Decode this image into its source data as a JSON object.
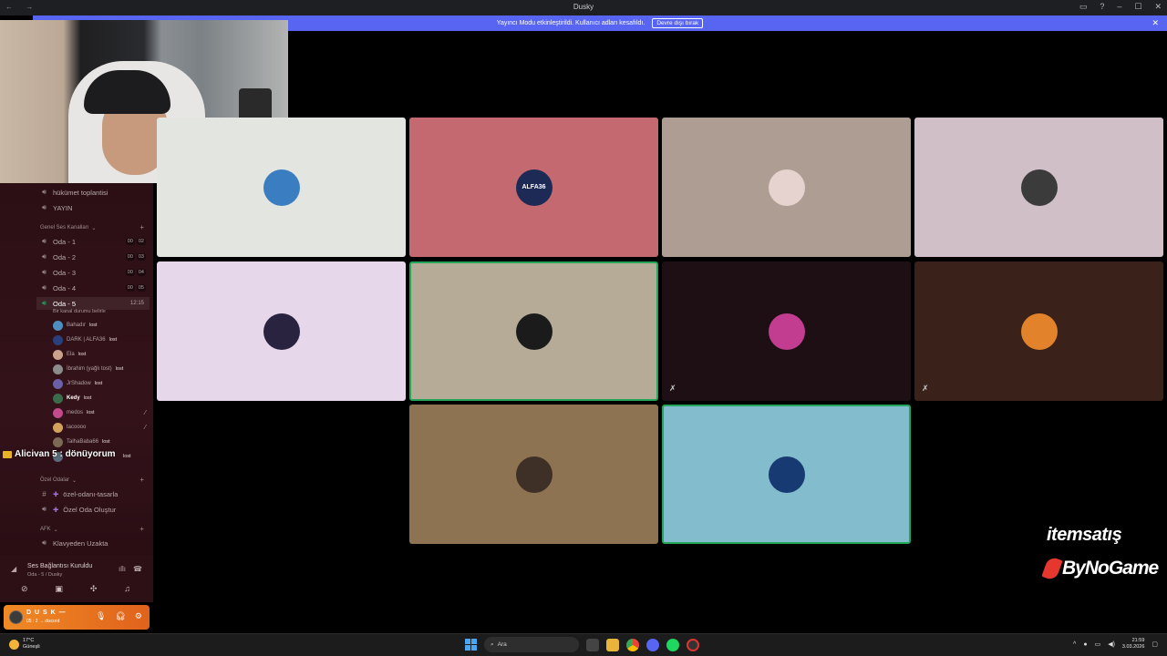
{
  "window": {
    "title": "Dusky",
    "nav_arrows": "← →"
  },
  "banner": {
    "text": "Yayıncı Modu etkinleştirildi. Kullanıcı adları kesafıldı.",
    "button": "Devre dışı bırak"
  },
  "sidebar": {
    "channels_top": [
      {
        "name": "hükümet toplantisi",
        "icon": "speaker-icon"
      },
      {
        "name": "YAYIN",
        "icon": "speaker-icon"
      }
    ],
    "category_voice": "Genel Ses Kanalları",
    "voice_channels": [
      {
        "name": "Oda - 1",
        "counts": [
          "00",
          "02"
        ]
      },
      {
        "name": "Oda - 2",
        "counts": [
          "00",
          "03"
        ]
      },
      {
        "name": "Oda - 3",
        "counts": [
          "00",
          "04"
        ]
      },
      {
        "name": "Oda - 4",
        "counts": [
          "00",
          "05"
        ]
      }
    ],
    "active_channel": {
      "name": "Oda - 5",
      "timer": "12:15",
      "status": "Bir kanal durumu belirle"
    },
    "members": [
      {
        "name": "Bahadır",
        "tag": "lost",
        "color": "#4f8fbf"
      },
      {
        "name": "DARK | ALFA36",
        "tag": "lost",
        "color": "#2b3f7a"
      },
      {
        "name": "Ela",
        "tag": "lost",
        "color": "#c9a38b"
      },
      {
        "name": "İbrahim (yağlı tost)",
        "tag": "lost",
        "color": "#8c8c8c"
      },
      {
        "name": "JrShadow",
        "tag": "lost",
        "color": "#6b5fa8"
      },
      {
        "name": "Kedy",
        "tag": "lost",
        "color": "#3c6b4b"
      },
      {
        "name": "medos",
        "tag": "lost",
        "color": "#c24a8d",
        "muted": true
      },
      {
        "name": "tacoooo",
        "tag": "",
        "color": "#d2a45b",
        "muted": true
      },
      {
        "name": "TalhaBaba66",
        "tag": "lost",
        "color": "#7a6a55"
      },
      {
        "name": "",
        "tag": "lost",
        "color": "#5a6c7a"
      }
    ],
    "overlay_name": "Alicivan 5 : dönüyorum",
    "category_private": "Özel Odalar",
    "private_channels": [
      {
        "name": "özel-odanı-tasarla"
      },
      {
        "name": "Özel Oda Oluştur"
      }
    ],
    "category_afk": "AFK",
    "afk_channel": "Klavyeden Uzakta"
  },
  "voice_panel": {
    "status": "Ses Bağlantısı Kuruldu",
    "sub": "Oda - 5 / Dusky"
  },
  "user_panel": {
    "name": "D U S K —",
    "sub": "05 : 2 → discord"
  },
  "tiles": [
    {
      "id": "tile-1",
      "bg": "#e3e5e1",
      "avatar_color": "#3b7dc1",
      "speaking": false,
      "muted": false
    },
    {
      "id": "tile-2",
      "bg": "#c4696f",
      "avatar_color": "#1d2a55",
      "avatar_text": "ALFA36",
      "speaking": false,
      "muted": false
    },
    {
      "id": "tile-3",
      "bg": "#ae9d93",
      "avatar_color": "#e6d3cf",
      "speaking": false,
      "muted": false
    },
    {
      "id": "tile-4",
      "bg": "#d0bfc7",
      "avatar_color": "#3b3b3b",
      "speaking": false,
      "muted": false
    },
    {
      "id": "tile-5",
      "bg": "#e6d7ea",
      "avatar_color": "#2a2340",
      "speaking": false,
      "muted": false
    },
    {
      "id": "tile-6",
      "bg": "#b6ab97",
      "avatar_color": "#1b1b1b",
      "speaking": true,
      "muted": false
    },
    {
      "id": "tile-7",
      "bg": "#1e0f14",
      "avatar_color": "#c23d8f",
      "speaking": false,
      "muted": true
    },
    {
      "id": "tile-8",
      "bg": "#3a2119",
      "avatar_color": "#e2822a",
      "speaking": false,
      "muted": true
    },
    {
      "id": "tile-9",
      "bg": "#8d7351",
      "avatar_color": "#3e3026",
      "speaking": false,
      "muted": false
    },
    {
      "id": "tile-10",
      "bg": "#83bccd",
      "avatar_color": "#173a73",
      "speaking": true,
      "muted": false
    }
  ],
  "sponsors": {
    "first": "itemsatış",
    "second": "ByNoGame"
  },
  "taskbar": {
    "temp": "17°C",
    "weather": "Güneşli",
    "search": "Ara",
    "time": "21:59",
    "date": "3.03.2026"
  }
}
